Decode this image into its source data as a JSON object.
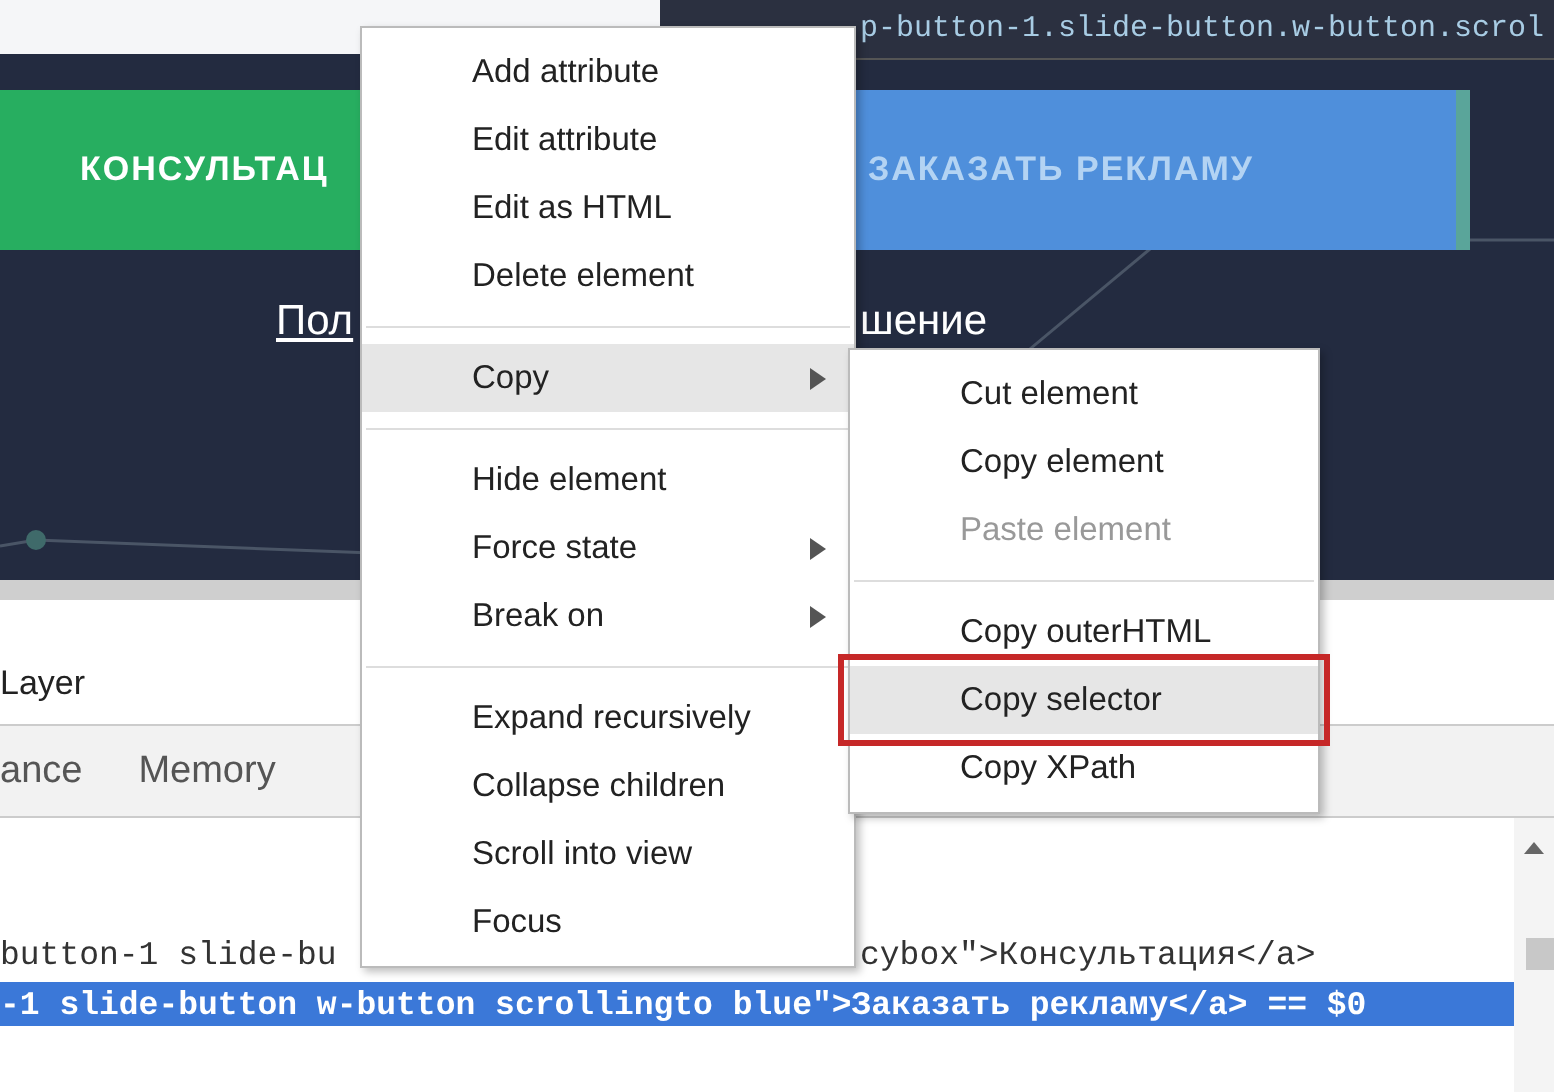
{
  "page": {
    "tooltip": "p-button-1.slide-button.w-button.scrol",
    "buttons": [
      {
        "label": "КОНСУЛЬТАЦ",
        "color": "#27ae60"
      },
      {
        "label": "ЗАКАЗАТЬ РЕКЛАМУ",
        "color": "#4f8fdb"
      }
    ],
    "link_parts": [
      "Пол",
      "шение"
    ]
  },
  "devtools": {
    "layer_label": "Layer",
    "tabs": [
      {
        "label": "ance",
        "selected": false
      },
      {
        "label": "Memory",
        "selected": false
      }
    ],
    "code_lines": [
      {
        "parts": [
          "button-1 slide-bu",
          "cybox\">Консультация</a>"
        ],
        "selected": false
      },
      {
        "parts": [
          "-1 slide-button w-button scrollingto blue\">Заказать рекламу</a> == $0"
        ],
        "selected": true
      }
    ]
  },
  "context_menu": {
    "items": [
      {
        "kind": "item",
        "label": "Add attribute",
        "selected": false
      },
      {
        "kind": "item",
        "label": "Edit attribute",
        "selected": false
      },
      {
        "kind": "item",
        "label": "Edit as HTML",
        "selected": false
      },
      {
        "kind": "item",
        "label": "Delete element",
        "selected": false
      },
      {
        "kind": "separator"
      },
      {
        "kind": "submenu",
        "label": "Copy",
        "selected": true
      },
      {
        "kind": "separator"
      },
      {
        "kind": "item",
        "label": "Hide element",
        "selected": false
      },
      {
        "kind": "submenu",
        "label": "Force state",
        "selected": false
      },
      {
        "kind": "submenu",
        "label": "Break on",
        "selected": false
      },
      {
        "kind": "separator"
      },
      {
        "kind": "item",
        "label": "Expand recursively",
        "selected": false
      },
      {
        "kind": "item",
        "label": "Collapse children",
        "selected": false
      },
      {
        "kind": "item",
        "label": "Scroll into view",
        "selected": false
      },
      {
        "kind": "item",
        "label": "Focus",
        "selected": false
      }
    ]
  },
  "copy_submenu": {
    "items": [
      {
        "kind": "item",
        "label": "Cut element",
        "selected": false,
        "disabled": false,
        "annotated": false
      },
      {
        "kind": "item",
        "label": "Copy element",
        "selected": false,
        "disabled": false,
        "annotated": false
      },
      {
        "kind": "item",
        "label": "Paste element",
        "selected": false,
        "disabled": true,
        "annotated": false
      },
      {
        "kind": "separator"
      },
      {
        "kind": "item",
        "label": "Copy outerHTML",
        "selected": false,
        "disabled": false,
        "annotated": false
      },
      {
        "kind": "item",
        "label": "Copy selector",
        "selected": true,
        "disabled": false,
        "annotated": true
      },
      {
        "kind": "item",
        "label": "Copy XPath",
        "selected": false,
        "disabled": false,
        "annotated": false
      }
    ]
  }
}
